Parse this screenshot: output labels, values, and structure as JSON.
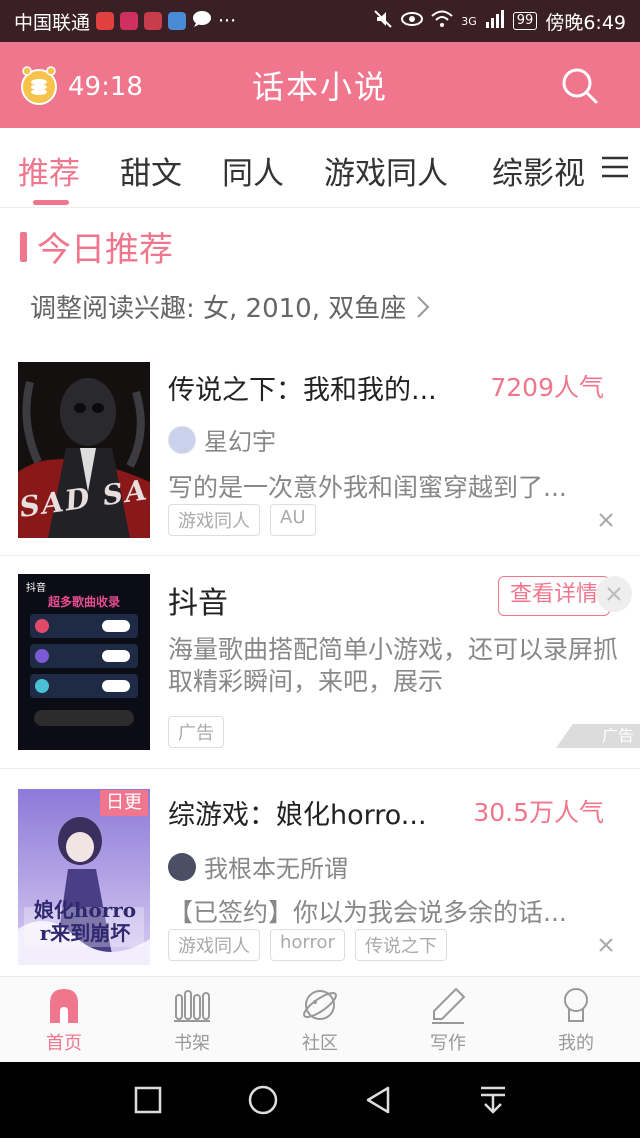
{
  "status_bar": {
    "carrier": "中国联通",
    "network": "3G",
    "battery": "99",
    "time": "傍晚6:49"
  },
  "header": {
    "timer": "49:18",
    "title": "话本小说"
  },
  "tabs": [
    {
      "label": "推荐",
      "active": true
    },
    {
      "label": "甜文",
      "active": false
    },
    {
      "label": "同人",
      "active": false
    },
    {
      "label": "游戏同人",
      "active": false
    },
    {
      "label": "综影视",
      "active": false
    }
  ],
  "section": {
    "title": "今日推荐",
    "interest": "调整阅读兴趣: 女, 2010, 双鱼座"
  },
  "books": [
    {
      "title": "传说之下：我和我的...",
      "popularity": "7209人气",
      "author": "星幻宇",
      "description": "写的是一次意外我和闺蜜穿越到了...",
      "tags": [
        "游戏同人",
        "AU"
      ],
      "cover_text": "SAD SA"
    },
    {
      "title": "综游戏：娘化horro...",
      "popularity": "30.5万人气",
      "author": "我根本无所谓",
      "description": "【已签约】你以为我会说多余的话...",
      "tags": [
        "游戏同人",
        "horror",
        "传说之下"
      ],
      "badge": "日更",
      "cover_text": "娘化horror来到崩坏"
    }
  ],
  "ad": {
    "name": "抖音",
    "button": "查看详情",
    "description": "海量歌曲搭配简单小游戏，还可以录屏抓取精彩瞬间，来吧，展示",
    "tag": "广告",
    "badge": "广告",
    "cover_brand": "抖音",
    "cover_heading": "超多歌曲收录"
  },
  "bottom_nav": [
    {
      "label": "首页",
      "icon": "home-icon",
      "active": true
    },
    {
      "label": "书架",
      "icon": "bookshelf-icon",
      "active": false
    },
    {
      "label": "社区",
      "icon": "planet-icon",
      "active": false
    },
    {
      "label": "写作",
      "icon": "pen-icon",
      "active": false
    },
    {
      "label": "我的",
      "icon": "profile-icon",
      "active": false
    }
  ],
  "colors": {
    "accent": "#f0768e",
    "status_bar": "#3a1f24"
  }
}
